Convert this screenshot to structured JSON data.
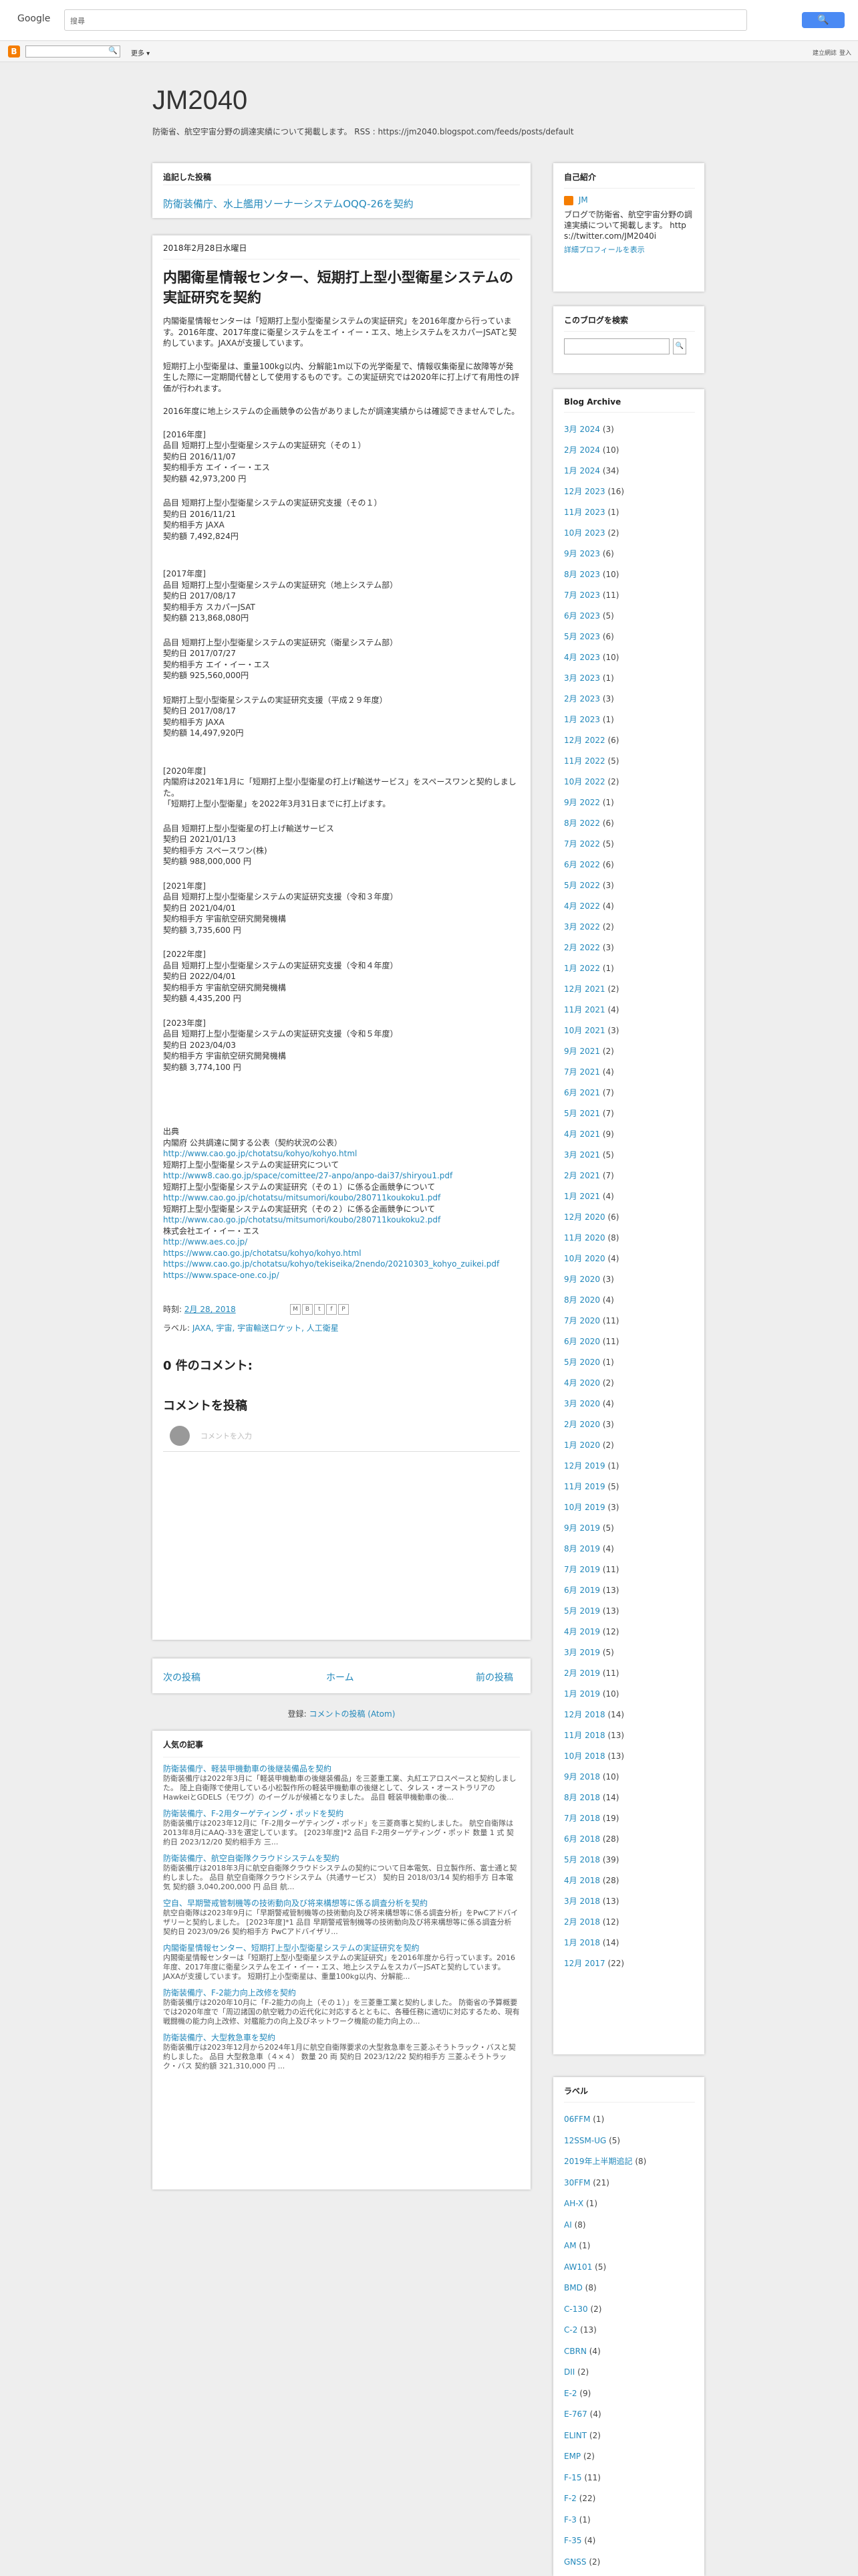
{
  "browser": {
    "logo": "Google",
    "search_placeholder": "搜尋",
    "search_button": "🔍"
  },
  "navbar": {
    "more": "更多 ▾",
    "right1": "建立網誌",
    "right2": "登入"
  },
  "blog": {
    "title": "JM2040",
    "description": "防衛省、航空宇宙分野の調達実績について掲載します。 RSS : https://jm2040.blogspot.com/feeds/posts/default"
  },
  "featured": {
    "heading": "追記した投稿",
    "link": "防衛装備庁、水上艦用ソーナーシステムOQQ-26を契約"
  },
  "post": {
    "date": "2018年2月28日水曜日",
    "title": "内閣衛星情報センター、短期打上型小型衛星システムの実証研究を契約",
    "paragraphs": [
      "内閣衛星情報センターは「短期打上型小型衛星システムの実証研究」を2016年度から行っています。2016年度、2017年度に衛星システムをエイ・イー・エス、地上システムをスカパーJSATと契約しています。JAXAが支援しています。",
      "短期打上小型衛星は、重量100kg以内、分解能1m以下の光学衛星で、情報収集衛星に故障等が発生した際に一定期間代替として使用するものです。この実証研究では2020年に打上げて有用性の評価が行われます。",
      "2016年度に地上システムの企画競争の公告がありましたが調達実績からは確認できませんでした。"
    ],
    "records": [
      {
        "lines": [
          "[2016年度]",
          "品目 短期打上型小型衛星システムの実証研究（その１）",
          "契約日 2016/11/07",
          "契約相手方 エイ・イー・エス",
          "契約額 42,973,200 円"
        ]
      },
      {
        "lines": [
          "品目 短期打上型小型衛星システムの実証研究支援（その１）",
          "契約日 2016/11/21",
          "契約相手方 JAXA",
          "契約額 7,492,824円"
        ]
      },
      {
        "lines": [
          "[2017年度]",
          "品目 短期打上型小型衛星システムの実証研究（地上システム部）",
          "契約日 2017/08/17",
          "契約相手方 スカパーJSAT",
          "契約額 213,868,080円"
        ]
      },
      {
        "lines": [
          "品目 短期打上型小型衛星システムの実証研究（衛星システム部）",
          "契約日 2017/07/27",
          "契約相手方 エイ・イー・エス",
          "契約額 925,560,000円"
        ]
      },
      {
        "lines": [
          "短期打上型小型衛星システムの実証研究支援（平成２９年度）",
          "契約日 2017/08/17",
          "契約相手方 JAXA",
          "契約額 14,497,920円"
        ]
      },
      {
        "lines": [
          "[2020年度]",
          "内閣府は2021年1月に「短期打上型小型衛星の打上げ輸送サービス」をスペースワンと契約しました。",
          "「短期打上型小型衛星」を2022年3月31日までに打上げます。"
        ]
      },
      {
        "lines": [
          "品目 短期打上型小型衛星の打上げ輸送サービス",
          "契約日 2021/01/13",
          "契約相手方 スペースワン(株)",
          "契約額 988,000,000 円"
        ]
      },
      {
        "lines": [
          "[2021年度]",
          "品目 短期打上型小型衛星システムの実証研究支援（令和３年度）",
          "契約日 2021/04/01",
          "契約相手方 宇宙航空研究開発機構",
          "契約額 3,735,600 円"
        ]
      },
      {
        "lines": [
          "[2022年度]",
          "品目 短期打上型小型衛星システムの実証研究支援（令和４年度）",
          "契約日 2022/04/01",
          "契約相手方 宇宙航空研究開発機構",
          "契約額 4,435,200 円"
        ]
      },
      {
        "lines": [
          "[2023年度]",
          "品目 短期打上型小型衛星システムの実証研究支援（令和５年度）",
          "契約日 2023/04/03",
          "契約相手方 宇宙航空研究開発機構",
          "契約額 3,774,100 円"
        ]
      }
    ],
    "sources": [
      {
        "text": "出典",
        "link": false
      },
      {
        "text": "内閣府 公共調達に関する公表（契約状況の公表）",
        "link": false
      },
      {
        "text": "http://www.cao.go.jp/chotatsu/kohyo/kohyo.html",
        "link": true
      },
      {
        "text": "短期打上型小型衛星システムの実証研究について",
        "link": false
      },
      {
        "text": "http://www8.cao.go.jp/space/comittee/27-anpo/anpo-dai37/shiryou1.pdf",
        "link": true
      },
      {
        "text": "短期打上型小型衛星システムの実証研究（その１）に係る企画競争について",
        "link": false
      },
      {
        "text": "http://www.cao.go.jp/chotatsu/mitsumori/koubo/280711koukoku1.pdf",
        "link": true
      },
      {
        "text": "短期打上型小型衛星システムの実証研究（その２）に係る企画競争について",
        "link": false
      },
      {
        "text": "http://www.cao.go.jp/chotatsu/mitsumori/koubo/280711koukoku2.pdf",
        "link": true
      },
      {
        "text": "株式会社エイ・イー・エス",
        "link": false
      },
      {
        "text": "http://www.aes.co.jp/",
        "link": true
      },
      {
        "text": "https://www.cao.go.jp/chotatsu/kohyo/kohyo.html",
        "link": true
      },
      {
        "text": "https://www.cao.go.jp/chotatsu/kohyo/tekiseika/2nendo/20210303_kohyo_zuikei.pdf",
        "link": true
      },
      {
        "text": "https://www.space-one.co.jp/",
        "link": true
      }
    ],
    "footer_time_label": "時刻:",
    "footer_time": "2月 28, 2018",
    "share_icons": [
      "M",
      "B",
      "t",
      "f",
      "P"
    ],
    "labels_label": "ラベル:",
    "labels": "JAXA, 宇宙, 宇宙輸送ロケット, 人工衛星",
    "comments_count": "0 件のコメント:",
    "comments_heading": "コメントを投稿",
    "comment_placeholder": "コメントを入力"
  },
  "pager": {
    "newer": "次の投稿",
    "home": "ホーム",
    "older": "前の投稿"
  },
  "subscribe": {
    "label": "登録:",
    "link": "コメントの投稿 (Atom)"
  },
  "popular": {
    "heading": "人気の記事",
    "items": [
      {
        "title": "防衛装備庁、軽装甲機動車の後継装備品を契約",
        "summary": "防衛装備庁は2022年3月に「軽装甲機動車の後継装備品」を三菱重工業、丸紅エアロスペースと契約しました。 陸上自衛隊で使用している小松製作所の軽装甲機動車の後継として、タレス・オーストラリアのHawkeiとGDELS（モワグ）のイーグルが候補となりました。 品目 軽装甲機動車の後..."
      },
      {
        "title": "防衛装備庁、F-2用ターゲティング・ポッドを契約",
        "summary": "防衛装備庁は2023年12月に「F-2用ターゲティング・ポッド」を三菱商事と契約しました。 航空自衛隊は2013年8月にAAQ-33を選定しています。 [2023年度]*2 品目 F-2用ターゲティング・ポッド 数量 1 式 契約日 2023/12/20 契約相手方 三..."
      },
      {
        "title": "防衛装備庁、航空自衛隊クラウドシステムを契約",
        "summary": "防衛装備庁は2018年3月に航空自衛隊クラウドシステムの契約について日本電気、日立製作所、富士通と契約しました。 品目 航空自衛隊クラウドシステム（共通サービス） 契約日 2018/03/14 契約相手方 日本電気 契約額 3,040,200,000 円 品目 航..."
      },
      {
        "title": "空自、早期警戒管制機等の技術動向及び将来構想等に係る調査分析を契約",
        "summary": "航空自衛隊は2023年9月に「早期警戒管制機等の技術動向及び将来構想等に係る調査分析」をPwCアドバイザリーと契約しました。 [2023年度]*1 品目 早期警戒管制機等の技術動向及び将来構想等に係る調査分析 契約日 2023/09/26 契約相手方 PwCアドバイザリ..."
      },
      {
        "title": "内閣衛星情報センター、短期打上型小型衛星システムの実証研究を契約",
        "summary": "内閣衛星情報センターは「短期打上型小型衛星システムの実証研究」を2016年度から行っています。2016年度、2017年度に衛星システムをエイ・イー・エス、地上システムをスカパーJSATと契約しています。JAXAが支援しています。 短期打上小型衛星は、重量100kg以内、分解能..."
      },
      {
        "title": "防衛装備庁、F-2能力向上改修を契約",
        "summary": "防衛装備庁は2020年10月に「F-2能力の向上（その１）」を三菱重工業と契約しました。 防衛省の予算概要では2020年度で「周辺諸国の航空戦力の近代化に対応するとともに、各種任務に適切に対応するため、現有戦闘機の能力向上改修、対艦能力の向上及びネットワーク機能の能力向上の..."
      },
      {
        "title": "防衛装備庁、大型救急車を契約",
        "summary": "防衛装備庁は2023年12月から2024年1月に航空自衛隊要求の大型救急車を三菱ふそうトラック・バスと契約しました。 品目 大型救急車（４×４） 数量 20 両 契約日 2023/12/22 契約相手方 三菱ふそうトラック・バス 契約額 321,310,000 円 ..."
      }
    ]
  },
  "sidebar": {
    "profile": {
      "heading": "自己紹介",
      "name": "JM",
      "text": "ブログで防衛省、航空宇宙分野の調達実績について掲載します。 https://twitter.com/JM2040i",
      "more": "詳細プロフィールを表示"
    },
    "search": {
      "heading": "このブログを検索",
      "button": "🔍"
    },
    "archive": {
      "heading": "Blog Archive",
      "items": [
        {
          "label": "3月 2024",
          "count": "(3)"
        },
        {
          "label": "2月 2024",
          "count": "(10)"
        },
        {
          "label": "1月 2024",
          "count": "(34)"
        },
        {
          "label": "12月 2023",
          "count": "(16)"
        },
        {
          "label": "11月 2023",
          "count": "(1)"
        },
        {
          "label": "10月 2023",
          "count": "(2)"
        },
        {
          "label": "9月 2023",
          "count": "(6)"
        },
        {
          "label": "8月 2023",
          "count": "(10)"
        },
        {
          "label": "7月 2023",
          "count": "(11)"
        },
        {
          "label": "6月 2023",
          "count": "(5)"
        },
        {
          "label": "5月 2023",
          "count": "(6)"
        },
        {
          "label": "4月 2023",
          "count": "(10)"
        },
        {
          "label": "3月 2023",
          "count": "(1)"
        },
        {
          "label": "2月 2023",
          "count": "(3)"
        },
        {
          "label": "1月 2023",
          "count": "(1)"
        },
        {
          "label": "12月 2022",
          "count": "(6)"
        },
        {
          "label": "11月 2022",
          "count": "(5)"
        },
        {
          "label": "10月 2022",
          "count": "(2)"
        },
        {
          "label": "9月 2022",
          "count": "(1)"
        },
        {
          "label": "8月 2022",
          "count": "(6)"
        },
        {
          "label": "7月 2022",
          "count": "(5)"
        },
        {
          "label": "6月 2022",
          "count": "(6)"
        },
        {
          "label": "5月 2022",
          "count": "(3)"
        },
        {
          "label": "4月 2022",
          "count": "(4)"
        },
        {
          "label": "3月 2022",
          "count": "(2)"
        },
        {
          "label": "2月 2022",
          "count": "(3)"
        },
        {
          "label": "1月 2022",
          "count": "(1)"
        },
        {
          "label": "12月 2021",
          "count": "(2)"
        },
        {
          "label": "11月 2021",
          "count": "(4)"
        },
        {
          "label": "10月 2021",
          "count": "(3)"
        },
        {
          "label": "9月 2021",
          "count": "(2)"
        },
        {
          "label": "7月 2021",
          "count": "(4)"
        },
        {
          "label": "6月 2021",
          "count": "(7)"
        },
        {
          "label": "5月 2021",
          "count": "(7)"
        },
        {
          "label": "4月 2021",
          "count": "(9)"
        },
        {
          "label": "3月 2021",
          "count": "(5)"
        },
        {
          "label": "2月 2021",
          "count": "(7)"
        },
        {
          "label": "1月 2021",
          "count": "(4)"
        },
        {
          "label": "12月 2020",
          "count": "(6)"
        },
        {
          "label": "11月 2020",
          "count": "(8)"
        },
        {
          "label": "10月 2020",
          "count": "(4)"
        },
        {
          "label": "9月 2020",
          "count": "(3)"
        },
        {
          "label": "8月 2020",
          "count": "(4)"
        },
        {
          "label": "7月 2020",
          "count": "(11)"
        },
        {
          "label": "6月 2020",
          "count": "(11)"
        },
        {
          "label": "5月 2020",
          "count": "(1)"
        },
        {
          "label": "4月 2020",
          "count": "(2)"
        },
        {
          "label": "3月 2020",
          "count": "(4)"
        },
        {
          "label": "2月 2020",
          "count": "(3)"
        },
        {
          "label": "1月 2020",
          "count": "(2)"
        },
        {
          "label": "12月 2019",
          "count": "(1)"
        },
        {
          "label": "11月 2019",
          "count": "(5)"
        },
        {
          "label": "10月 2019",
          "count": "(3)"
        },
        {
          "label": "9月 2019",
          "count": "(5)"
        },
        {
          "label": "8月 2019",
          "count": "(4)"
        },
        {
          "label": "7月 2019",
          "count": "(11)"
        },
        {
          "label": "6月 2019",
          "count": "(13)"
        },
        {
          "label": "5月 2019",
          "count": "(13)"
        },
        {
          "label": "4月 2019",
          "count": "(12)"
        },
        {
          "label": "3月 2019",
          "count": "(5)"
        },
        {
          "label": "2月 2019",
          "count": "(11)"
        },
        {
          "label": "1月 2019",
          "count": "(10)"
        },
        {
          "label": "12月 2018",
          "count": "(14)"
        },
        {
          "label": "11月 2018",
          "count": "(13)"
        },
        {
          "label": "10月 2018",
          "count": "(13)"
        },
        {
          "label": "9月 2018",
          "count": "(10)"
        },
        {
          "label": "8月 2018",
          "count": "(14)"
        },
        {
          "label": "7月 2018",
          "count": "(19)"
        },
        {
          "label": "6月 2018",
          "count": "(28)"
        },
        {
          "label": "5月 2018",
          "count": "(39)"
        },
        {
          "label": "4月 2018",
          "count": "(28)"
        },
        {
          "label": "3月 2018",
          "count": "(13)"
        },
        {
          "label": "2月 2018",
          "count": "(12)"
        },
        {
          "label": "1月 2018",
          "count": "(14)"
        },
        {
          "label": "12月 2017",
          "count": "(22)"
        }
      ]
    },
    "labels": {
      "heading": "ラベル",
      "items": [
        {
          "label": "06FFM",
          "count": "(1)"
        },
        {
          "label": "12SSM-UG",
          "count": "(5)"
        },
        {
          "label": "2019年上半期追記",
          "count": "(8)"
        },
        {
          "label": "30FFM",
          "count": "(21)"
        },
        {
          "label": "AH-X",
          "count": "(1)"
        },
        {
          "label": "AI",
          "count": "(8)"
        },
        {
          "label": "AM",
          "count": "(1)"
        },
        {
          "label": "AW101",
          "count": "(5)"
        },
        {
          "label": "BMD",
          "count": "(8)"
        },
        {
          "label": "C-130",
          "count": "(2)"
        },
        {
          "label": "C-2",
          "count": "(13)"
        },
        {
          "label": "CBRN",
          "count": "(4)"
        },
        {
          "label": "DII",
          "count": "(2)"
        },
        {
          "label": "E-2",
          "count": "(9)"
        },
        {
          "label": "E-767",
          "count": "(4)"
        },
        {
          "label": "ELINT",
          "count": "(2)"
        },
        {
          "label": "EMP",
          "count": "(2)"
        },
        {
          "label": "F-15",
          "count": "(11)"
        },
        {
          "label": "F-2",
          "count": "(22)"
        },
        {
          "label": "F-3",
          "count": "(1)"
        },
        {
          "label": "F-35",
          "count": "(4)"
        },
        {
          "label": "GNSS",
          "count": "(2)"
        }
      ]
    }
  }
}
